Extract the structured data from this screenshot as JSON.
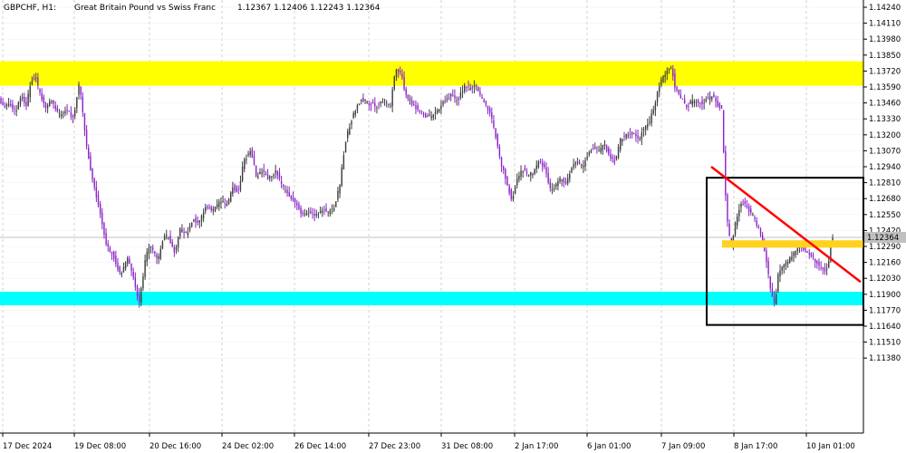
{
  "header": {
    "symbol": "GBPCHF, H1:",
    "name": "Great Britain Pound vs Swiss Franc",
    "ohlc": "1.12367 1.12406 1.12243 1.12364"
  },
  "colors": {
    "bull_candle": "#3c3c3c",
    "bear_candle": "#8b22c7",
    "grid": "#d2d2d2",
    "resistance_zone": "#ffff00",
    "support_zone": "#00ffff",
    "trendline": "#ff0000",
    "box": "#000000",
    "small_zone": "#ffd21e",
    "price_line": "#c0c0c0"
  },
  "current_price_label": "1.12364",
  "chart_data": {
    "type": "candlestick",
    "title": "GBPCHF, H1:  Great Britain Pound vs Swiss Franc",
    "xlabel": "",
    "ylabel": "",
    "ylim": [
      1.1132,
      1.1428
    ],
    "y_ticks": [
      "1.14240",
      "1.14110",
      "1.13980",
      "1.13850",
      "1.13720",
      "1.13590",
      "1.13460",
      "1.13330",
      "1.13200",
      "1.13070",
      "1.12940",
      "1.12810",
      "1.12680",
      "1.12550",
      "1.12420",
      "1.12290",
      "1.12160",
      "1.12030",
      "1.11900",
      "1.11770",
      "1.11640",
      "1.11510",
      "1.11380"
    ],
    "x_ticks": [
      "17 Dec 2024",
      "19 Dec 08:00",
      "20 Dec 16:00",
      "24 Dec 02:00",
      "26 Dec 14:00",
      "27 Dec 23:00",
      "31 Dec 08:00",
      "2 Jan 17:00",
      "6 Jan 01:00",
      "7 Jan 09:00",
      "8 Jan 17:00",
      "10 Jan 01:00"
    ],
    "grid": true,
    "path_series": {
      "name": "GBPCHF H1",
      "points": [
        [
          0,
          1.135
        ],
        [
          6,
          1.1343
        ],
        [
          12,
          1.1346
        ],
        [
          18,
          1.1338
        ],
        [
          24,
          1.1352
        ],
        [
          30,
          1.1345
        ],
        [
          36,
          1.1365
        ],
        [
          40,
          1.1368
        ],
        [
          44,
          1.1355
        ],
        [
          52,
          1.1342
        ],
        [
          58,
          1.1348
        ],
        [
          66,
          1.1336
        ],
        [
          74,
          1.1341
        ],
        [
          82,
          1.1334
        ],
        [
          88,
          1.136
        ],
        [
          91,
          1.1348
        ],
        [
          96,
          1.1313
        ],
        [
          102,
          1.1288
        ],
        [
          110,
          1.1262
        ],
        [
          118,
          1.1232
        ],
        [
          126,
          1.1222
        ],
        [
          134,
          1.1205
        ],
        [
          142,
          1.122
        ],
        [
          148,
          1.1203
        ],
        [
          155,
          1.1183
        ],
        [
          162,
          1.1222
        ],
        [
          168,
          1.123
        ],
        [
          175,
          1.1216
        ],
        [
          182,
          1.1238
        ],
        [
          188,
          1.1236
        ],
        [
          194,
          1.1224
        ],
        [
          200,
          1.1243
        ],
        [
          207,
          1.1238
        ],
        [
          214,
          1.1252
        ],
        [
          220,
          1.1246
        ],
        [
          228,
          1.1262
        ],
        [
          236,
          1.1258
        ],
        [
          244,
          1.1266
        ],
        [
          252,
          1.1262
        ],
        [
          258,
          1.1278
        ],
        [
          264,
          1.1272
        ],
        [
          270,
          1.1298
        ],
        [
          278,
          1.1308
        ],
        [
          284,
          1.1286
        ],
        [
          290,
          1.129
        ],
        [
          298,
          1.1284
        ],
        [
          306,
          1.129
        ],
        [
          314,
          1.1276
        ],
        [
          322,
          1.127
        ],
        [
          328,
          1.1264
        ],
        [
          334,
          1.1254
        ],
        [
          342,
          1.1258
        ],
        [
          350,
          1.1255
        ],
        [
          358,
          1.126
        ],
        [
          364,
          1.1256
        ],
        [
          370,
          1.1262
        ],
        [
          376,
          1.1278
        ],
        [
          382,
          1.1314
        ],
        [
          388,
          1.133
        ],
        [
          394,
          1.1342
        ],
        [
          400,
          1.1349
        ],
        [
          408,
          1.1346
        ],
        [
          416,
          1.1343
        ],
        [
          424,
          1.1348
        ],
        [
          432,
          1.1344
        ],
        [
          438,
          1.1375
        ],
        [
          444,
          1.137
        ],
        [
          448,
          1.1352
        ],
        [
          456,
          1.1346
        ],
        [
          464,
          1.134
        ],
        [
          472,
          1.1334
        ],
        [
          480,
          1.1336
        ],
        [
          490,
          1.1346
        ],
        [
          498,
          1.1352
        ],
        [
          506,
          1.1348
        ],
        [
          514,
          1.136
        ],
        [
          520,
          1.1357
        ],
        [
          526,
          1.1362
        ],
        [
          530,
          1.1352
        ],
        [
          536,
          1.1346
        ],
        [
          542,
          1.1338
        ],
        [
          548,
          1.132
        ],
        [
          554,
          1.1297
        ],
        [
          560,
          1.1282
        ],
        [
          566,
          1.1267
        ],
        [
          572,
          1.1284
        ],
        [
          578,
          1.1292
        ],
        [
          584,
          1.1286
        ],
        [
          590,
          1.129
        ],
        [
          596,
          1.1299
        ],
        [
          602,
          1.1294
        ],
        [
          608,
          1.1276
        ],
        [
          614,
          1.1278
        ],
        [
          620,
          1.1284
        ],
        [
          626,
          1.128
        ],
        [
          632,
          1.1293
        ],
        [
          638,
          1.1298
        ],
        [
          644,
          1.1294
        ],
        [
          650,
          1.1304
        ],
        [
          656,
          1.131
        ],
        [
          662,
          1.1306
        ],
        [
          668,
          1.1312
        ],
        [
          674,
          1.1302
        ],
        [
          680,
          1.1298
        ],
        [
          686,
          1.1316
        ],
        [
          692,
          1.132
        ],
        [
          698,
          1.1322
        ],
        [
          706,
          1.1316
        ],
        [
          712,
          1.1326
        ],
        [
          718,
          1.133
        ],
        [
          724,
          1.1346
        ],
        [
          730,
          1.1364
        ],
        [
          736,
          1.137
        ],
        [
          742,
          1.1376
        ],
        [
          746,
          1.136
        ],
        [
          752,
          1.135
        ],
        [
          758,
          1.1344
        ],
        [
          764,
          1.1346
        ],
        [
          770,
          1.1348
        ],
        [
          776,
          1.1346
        ],
        [
          782,
          1.135
        ],
        [
          788,
          1.1352
        ],
        [
          794,
          1.1344
        ],
        [
          798,
          1.134
        ],
        [
          801,
          1.128
        ],
        [
          804,
          1.1248
        ],
        [
          808,
          1.1228
        ],
        [
          812,
          1.1246
        ],
        [
          816,
          1.1258
        ],
        [
          820,
          1.1266
        ],
        [
          826,
          1.126
        ],
        [
          832,
          1.1254
        ],
        [
          838,
          1.1244
        ],
        [
          844,
          1.123
        ],
        [
          848,
          1.1212
        ],
        [
          852,
          1.119
        ],
        [
          856,
          1.118
        ],
        [
          860,
          1.1206
        ],
        [
          866,
          1.1214
        ],
        [
          872,
          1.1218
        ],
        [
          878,
          1.1224
        ],
        [
          884,
          1.123
        ],
        [
          890,
          1.1226
        ],
        [
          896,
          1.1222
        ],
        [
          902,
          1.1216
        ],
        [
          908,
          1.1212
        ],
        [
          912,
          1.1208
        ],
        [
          916,
          1.1218
        ],
        [
          920,
          1.1236
        ]
      ]
    },
    "annotations": {
      "resistance_zone": {
        "y_low": 1.136,
        "y_high": 1.138
      },
      "support_zone": {
        "y_low": 1.1181,
        "y_high": 1.1192
      },
      "box": {
        "x_start_date": "8 Jan 17:00",
        "y_low": 1.1165,
        "y_high": 1.1285
      },
      "trendline": {
        "y_start": 1.1294,
        "y_end": 1.12
      },
      "small_zone": {
        "y_low": 1.1228,
        "y_high": 1.1234
      },
      "price_line": 1.12364
    }
  }
}
